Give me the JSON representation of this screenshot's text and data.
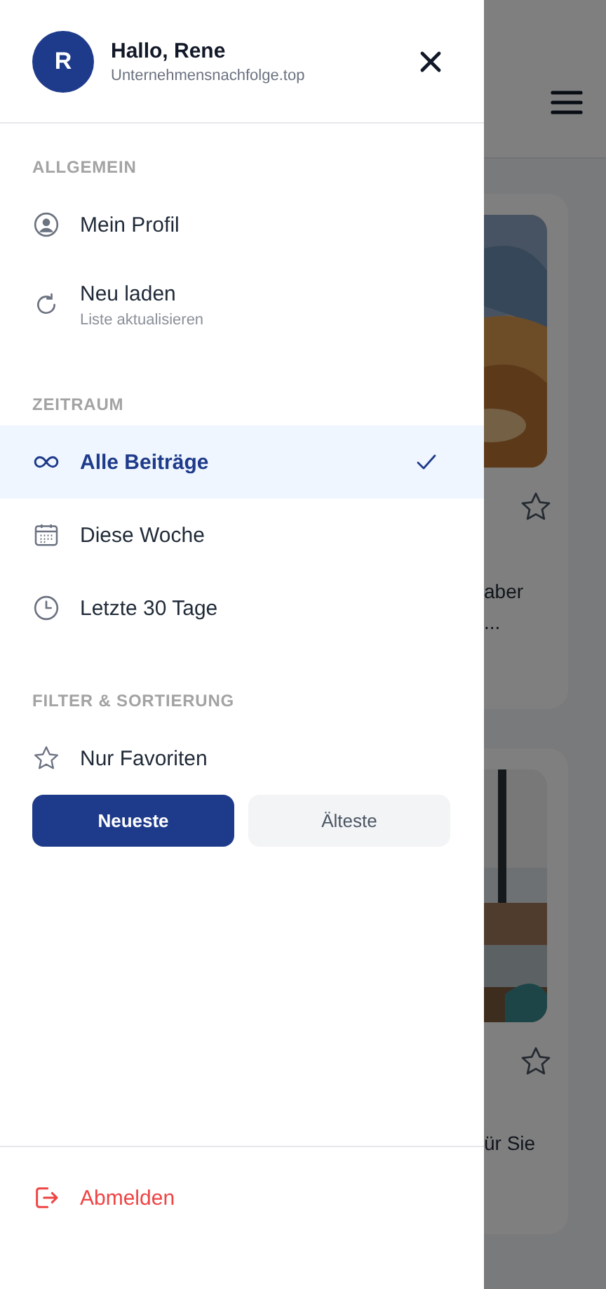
{
  "drawer": {
    "user": {
      "initial": "R",
      "greeting": "Hallo, Rene",
      "site": "Unternehmensnachfolge.top"
    },
    "sections": [
      {
        "title": "ALLGEMEIN",
        "items": [
          {
            "kind": "profile",
            "label": "Mein Profil",
            "selected": false
          },
          {
            "kind": "reload",
            "label": "Neu laden",
            "sublabel": "Liste aktualisieren",
            "selected": false
          }
        ]
      },
      {
        "title": "ZEITRAUM",
        "items": [
          {
            "kind": "infinity",
            "label": "Alle Beiträge",
            "selected": true
          },
          {
            "kind": "calendar",
            "label": "Diese Woche",
            "selected": false
          },
          {
            "kind": "clock",
            "label": "Letzte 30 Tage",
            "selected": false
          }
        ]
      },
      {
        "title": "FILTER & SORTIERUNG",
        "items": [
          {
            "kind": "star",
            "label": "Nur Favoriten",
            "selected": false
          }
        ]
      }
    ],
    "sort_buttons": [
      {
        "label": "Neueste",
        "selected": true
      },
      {
        "label": "Älteste",
        "selected": false
      }
    ],
    "logout": "Abmelden"
  },
  "background": {
    "cards": [
      {
        "lines": [
          "aber",
          "..."
        ]
      },
      {
        "lines": [
          "ür Sie"
        ]
      }
    ]
  }
}
